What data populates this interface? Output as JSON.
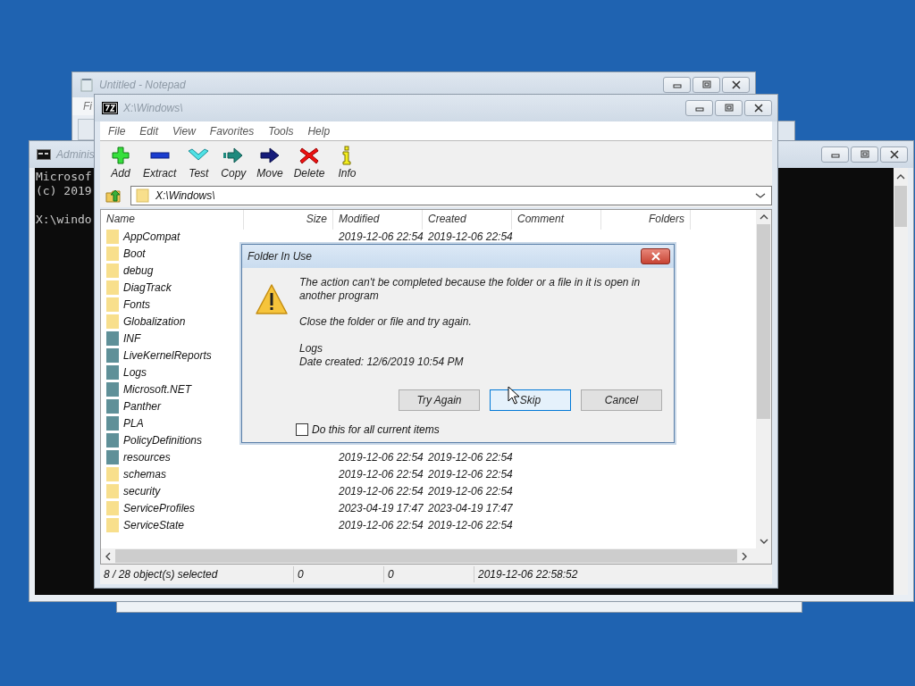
{
  "notepad": {
    "title": "Untitled - Notepad",
    "menu": [
      "Fi"
    ]
  },
  "console": {
    "title": "Adminis",
    "paragraphs": [
      [
        "Microsof",
        "(c) 2019"
      ],
      [
        "X:\\windo"
      ]
    ]
  },
  "archiver": {
    "title": "X:\\Windows\\",
    "menu": [
      "File",
      "Edit",
      "View",
      "Favorites",
      "Tools",
      "Help"
    ],
    "toolbar": [
      {
        "label": "Add",
        "kind": "add"
      },
      {
        "label": "Extract",
        "kind": "extract"
      },
      {
        "label": "Test",
        "kind": "test"
      },
      {
        "label": "Copy",
        "kind": "copy"
      },
      {
        "label": "Move",
        "kind": "move"
      },
      {
        "label": "Delete",
        "kind": "delete"
      },
      {
        "label": "Info",
        "kind": "info"
      }
    ],
    "address": "X:\\Windows\\",
    "columns": [
      "Name",
      "Size",
      "Modified",
      "Created",
      "Comment",
      "Folders"
    ],
    "rows": [
      {
        "name": "AppCompat",
        "selected": false,
        "modified": "2019-12-06 22:54",
        "created": "2019-12-06 22:54"
      },
      {
        "name": "Boot",
        "selected": false
      },
      {
        "name": "debug",
        "selected": false
      },
      {
        "name": "DiagTrack",
        "selected": false
      },
      {
        "name": "Fonts",
        "selected": false
      },
      {
        "name": "Globalization",
        "selected": false
      },
      {
        "name": "INF",
        "selected": true
      },
      {
        "name": "LiveKernelReports",
        "selected": true
      },
      {
        "name": "Logs",
        "selected": true
      },
      {
        "name": "Microsoft.NET",
        "selected": true
      },
      {
        "name": "Panther",
        "selected": true
      },
      {
        "name": "PLA",
        "selected": true
      },
      {
        "name": "PolicyDefinitions",
        "selected": true
      },
      {
        "name": "resources",
        "selected": true,
        "modified": "2019-12-06 22:54",
        "created": "2019-12-06 22:54"
      },
      {
        "name": "schemas",
        "selected": false,
        "modified": "2019-12-06 22:54",
        "created": "2019-12-06 22:54"
      },
      {
        "name": "security",
        "selected": false,
        "modified": "2019-12-06 22:54",
        "created": "2019-12-06 22:54"
      },
      {
        "name": "ServiceProfiles",
        "selected": false,
        "modified": "2023-04-19 17:47",
        "created": "2023-04-19 17:47"
      },
      {
        "name": "ServiceState",
        "selected": false,
        "modified": "2019-12-06 22:54",
        "created": "2019-12-06 22:54"
      }
    ],
    "status": [
      "8 / 28 object(s) selected",
      "0",
      "0",
      "2019-12-06 22:58:52"
    ]
  },
  "dialog": {
    "title": "Folder In Use",
    "message": "The action can't be completed because the folder or a file in it is open in another program",
    "hint": "Close the folder or file and try again.",
    "item_name": "Logs",
    "item_date": "Date created: 12/6/2019 10:54 PM",
    "buttons": [
      {
        "label": "Try Again",
        "focused": false
      },
      {
        "label": "Skip",
        "focused": true
      },
      {
        "label": "Cancel",
        "focused": false
      }
    ],
    "checkbox": {
      "label": "Do this for all current items",
      "checked": false
    }
  }
}
